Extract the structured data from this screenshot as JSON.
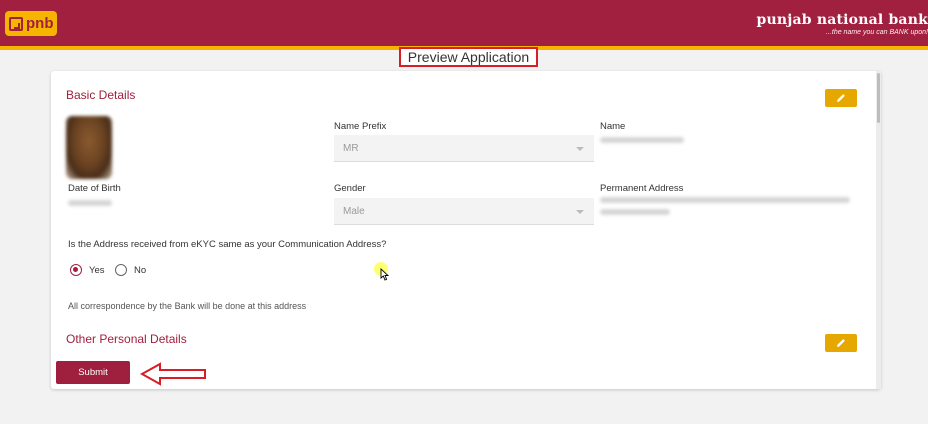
{
  "header": {
    "logo_text": "pnb",
    "bank_name": "punjab national bank",
    "tagline": "...the name you can BANK upon!"
  },
  "page_title": "Preview Application",
  "basic_details": {
    "section_title": "Basic Details",
    "fields": {
      "name_prefix_label": "Name Prefix",
      "name_prefix_value": "MR",
      "name_label": "Name",
      "dob_label": "Date of Birth",
      "gender_label": "Gender",
      "gender_value": "Male",
      "permanent_address_label": "Permanent Address"
    },
    "address_question": "Is the Address received from eKYC same as your Communication Address?",
    "options": {
      "yes": "Yes",
      "no": "No",
      "selected": "Yes"
    },
    "correspondence_note": "All correspondence by the Bank will be done at this address"
  },
  "other_details": {
    "section_title": "Other Personal Details"
  },
  "actions": {
    "submit_label": "Submit"
  },
  "colors": {
    "brand": "#a1203f",
    "accent": "#f4b400",
    "annotation": "#d81e24"
  },
  "icons": [
    "edit-pencil-icon",
    "radio-icon",
    "caret-down-icon",
    "arrow-annotation",
    "mouse-cursor-icon"
  ]
}
